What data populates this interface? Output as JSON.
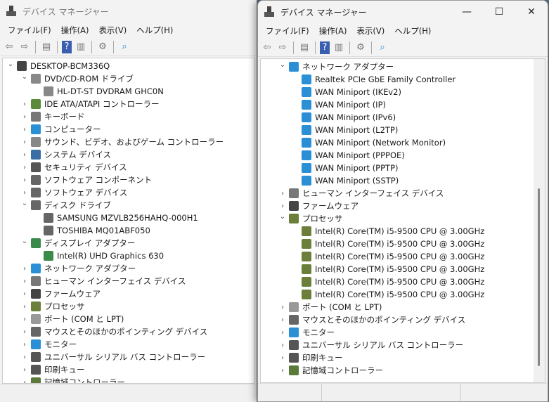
{
  "title": "デバイス マネージャー",
  "menu": [
    "ファイル(F)",
    "操作(A)",
    "表示(V)",
    "ヘルプ(H)"
  ],
  "toolbar": [
    "back-icon",
    "forward-icon",
    "show-hide-tree-icon",
    "help-icon",
    "properties-icon",
    "update-driver-icon",
    "scan-hardware-icon"
  ],
  "left_tree": [
    {
      "level": 0,
      "chev": "down",
      "icon": "computer",
      "label": "DESKTOP-BCM336Q"
    },
    {
      "level": 1,
      "chev": "down",
      "icon": "dvd",
      "label": "DVD/CD-ROM ドライブ"
    },
    {
      "level": 2,
      "icon": "dvd",
      "label": "HL-DT-ST DVDRAM GHC0N"
    },
    {
      "level": 1,
      "chev": "right",
      "icon": "ide",
      "label": "IDE ATA/ATAPI コントローラー"
    },
    {
      "level": 1,
      "chev": "right",
      "icon": "keyboard",
      "label": "キーボード"
    },
    {
      "level": 1,
      "chev": "right",
      "icon": "monitor",
      "label": "コンピューター"
    },
    {
      "level": 1,
      "chev": "right",
      "icon": "sound",
      "label": "サウンド、ビデオ、およびゲーム コントローラー"
    },
    {
      "level": 1,
      "chev": "right",
      "icon": "system",
      "label": "システム デバイス"
    },
    {
      "level": 1,
      "chev": "right",
      "icon": "security",
      "label": "セキュリティ デバイス"
    },
    {
      "level": 1,
      "chev": "right",
      "icon": "software",
      "label": "ソフトウェア コンポーネント"
    },
    {
      "level": 1,
      "chev": "right",
      "icon": "software",
      "label": "ソフトウェア デバイス"
    },
    {
      "level": 1,
      "chev": "down",
      "icon": "disk",
      "label": "ディスク ドライブ"
    },
    {
      "level": 2,
      "icon": "disk",
      "label": "SAMSUNG MZVLB256HAHQ-000H1"
    },
    {
      "level": 2,
      "icon": "disk",
      "label": "TOSHIBA MQ01ABF050"
    },
    {
      "level": 1,
      "chev": "down",
      "icon": "display",
      "label": "ディスプレイ アダプター"
    },
    {
      "level": 2,
      "icon": "display",
      "label": "Intel(R) UHD Graphics 630"
    },
    {
      "level": 1,
      "chev": "right",
      "icon": "network",
      "label": "ネットワーク アダプター"
    },
    {
      "level": 1,
      "chev": "right",
      "icon": "hid",
      "label": "ヒューマン インターフェイス デバイス"
    },
    {
      "level": 1,
      "chev": "right",
      "icon": "firmware",
      "label": "ファームウェア"
    },
    {
      "level": 1,
      "chev": "right",
      "icon": "cpu",
      "label": "プロセッサ"
    },
    {
      "level": 1,
      "chev": "right",
      "icon": "port",
      "label": "ポート (COM と LPT)"
    },
    {
      "level": 1,
      "chev": "right",
      "icon": "mouse",
      "label": "マウスとそのほかのポインティング デバイス"
    },
    {
      "level": 1,
      "chev": "right",
      "icon": "monitor",
      "label": "モニター"
    },
    {
      "level": 1,
      "chev": "right",
      "icon": "usb",
      "label": "ユニバーサル シリアル バス コントローラー"
    },
    {
      "level": 1,
      "chev": "right",
      "icon": "printer",
      "label": "印刷キュー"
    },
    {
      "level": 1,
      "chev": "right",
      "icon": "storage",
      "label": "記憶域コントローラー"
    }
  ],
  "right_tree": [
    {
      "level": 1,
      "chev": "down",
      "icon": "network",
      "label": "ネットワーク アダプター"
    },
    {
      "level": 2,
      "icon": "network",
      "label": "Realtek PCIe GbE Family Controller"
    },
    {
      "level": 2,
      "icon": "network",
      "label": "WAN Miniport (IKEv2)"
    },
    {
      "level": 2,
      "icon": "network",
      "label": "WAN Miniport (IP)"
    },
    {
      "level": 2,
      "icon": "network",
      "label": "WAN Miniport (IPv6)"
    },
    {
      "level": 2,
      "icon": "network",
      "label": "WAN Miniport (L2TP)"
    },
    {
      "level": 2,
      "icon": "network",
      "label": "WAN Miniport (Network Monitor)"
    },
    {
      "level": 2,
      "icon": "network",
      "label": "WAN Miniport (PPPOE)"
    },
    {
      "level": 2,
      "icon": "network",
      "label": "WAN Miniport (PPTP)"
    },
    {
      "level": 2,
      "icon": "network",
      "label": "WAN Miniport (SSTP)"
    },
    {
      "level": 1,
      "chev": "right",
      "icon": "hid",
      "label": "ヒューマン インターフェイス デバイス"
    },
    {
      "level": 1,
      "chev": "right",
      "icon": "firmware",
      "label": "ファームウェア"
    },
    {
      "level": 1,
      "chev": "down",
      "icon": "cpu",
      "label": "プロセッサ"
    },
    {
      "level": 2,
      "icon": "cpu",
      "label": "Intel(R) Core(TM) i5-9500 CPU @ 3.00GHz"
    },
    {
      "level": 2,
      "icon": "cpu",
      "label": "Intel(R) Core(TM) i5-9500 CPU @ 3.00GHz"
    },
    {
      "level": 2,
      "icon": "cpu",
      "label": "Intel(R) Core(TM) i5-9500 CPU @ 3.00GHz"
    },
    {
      "level": 2,
      "icon": "cpu",
      "label": "Intel(R) Core(TM) i5-9500 CPU @ 3.00GHz"
    },
    {
      "level": 2,
      "icon": "cpu",
      "label": "Intel(R) Core(TM) i5-9500 CPU @ 3.00GHz"
    },
    {
      "level": 2,
      "icon": "cpu",
      "label": "Intel(R) Core(TM) i5-9500 CPU @ 3.00GHz"
    },
    {
      "level": 1,
      "chev": "right",
      "icon": "port",
      "label": "ポート (COM と LPT)"
    },
    {
      "level": 1,
      "chev": "right",
      "icon": "mouse",
      "label": "マウスとそのほかのポインティング デバイス"
    },
    {
      "level": 1,
      "chev": "right",
      "icon": "monitor",
      "label": "モニター"
    },
    {
      "level": 1,
      "chev": "right",
      "icon": "usb",
      "label": "ユニバーサル シリアル バス コントローラー"
    },
    {
      "level": 1,
      "chev": "right",
      "icon": "printer",
      "label": "印刷キュー"
    },
    {
      "level": 1,
      "chev": "right",
      "icon": "storage",
      "label": "記憶域コントローラー"
    }
  ],
  "icon_colors": {
    "computer": "#444",
    "dvd": "#888",
    "ide": "#5a8a3a",
    "keyboard": "#777",
    "monitor": "#2b8fd6",
    "sound": "#888",
    "system": "#3a6ea5",
    "security": "#555",
    "software": "#666",
    "disk": "#666",
    "display": "#3a8a4a",
    "network": "#2b8fd6",
    "hid": "#777",
    "firmware": "#444",
    "cpu": "#6b7f3a",
    "port": "#999",
    "mouse": "#666",
    "usb": "#555",
    "printer": "#555",
    "storage": "#5a7a3a"
  },
  "right_scroll_position": 0.55
}
